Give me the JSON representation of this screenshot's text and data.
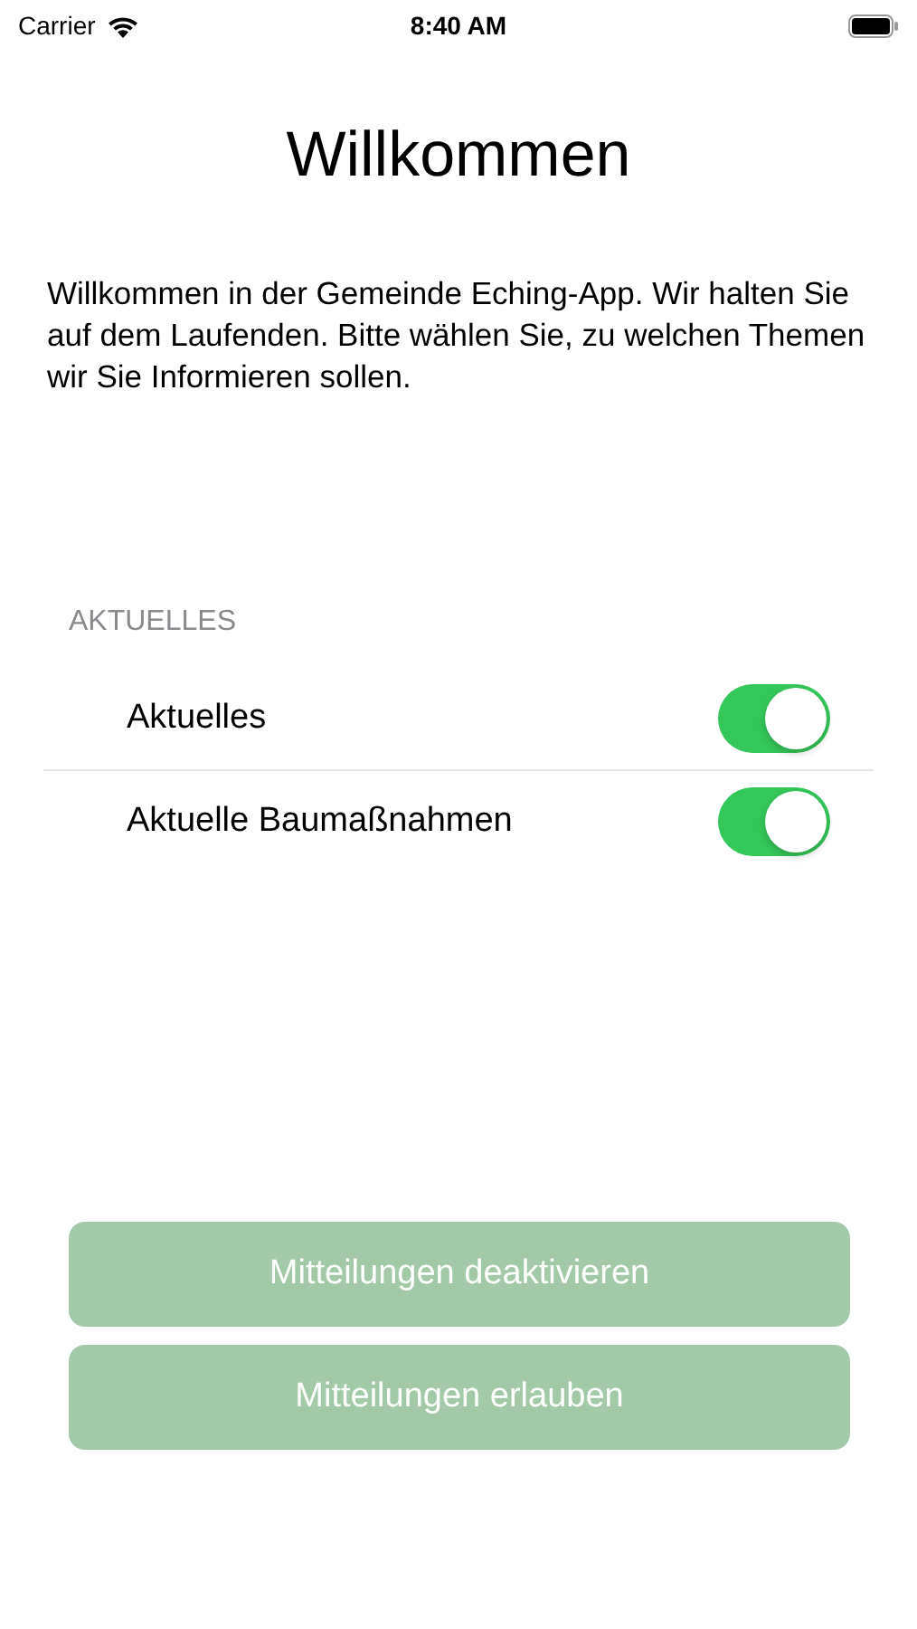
{
  "status_bar": {
    "carrier": "Carrier",
    "time": "8:40 AM"
  },
  "title": "Willkommen",
  "intro": "Willkommen in der Gemeinde Eching-App. Wir halten Sie auf dem Laufenden. Bitte wählen Sie, zu welchen Themen wir Sie Informieren sollen.",
  "section": {
    "header": "AKTUELLES",
    "items": [
      {
        "label": "Aktuelles",
        "on": true
      },
      {
        "label": "Aktuelle Baumaßnahmen",
        "on": true
      }
    ]
  },
  "buttons": [
    {
      "label": "Mitteilungen deaktivieren",
      "disabled": true
    },
    {
      "label": "Mitteilungen erlauben",
      "disabled": true
    }
  ]
}
